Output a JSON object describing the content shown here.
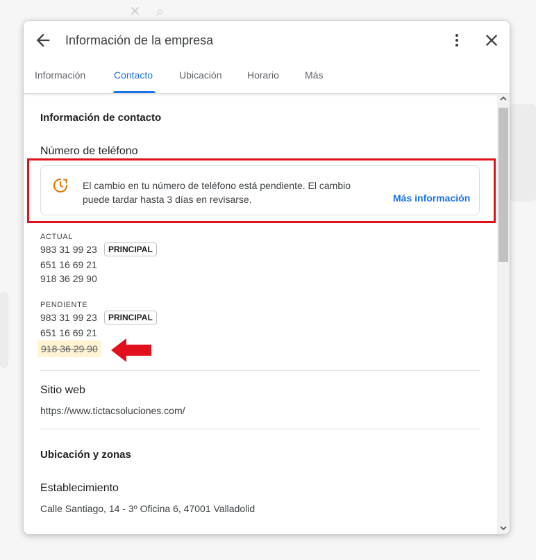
{
  "dialog": {
    "title": "Información de la empresa"
  },
  "tabs": [
    {
      "label": "Información",
      "active": false
    },
    {
      "label": "Contacto",
      "active": true
    },
    {
      "label": "Ubicación",
      "active": false
    },
    {
      "label": "Horario",
      "active": false
    },
    {
      "label": "Más",
      "active": false
    }
  ],
  "contact": {
    "section_title": "Información de contacto",
    "phone_title": "Número de teléfono",
    "notice": {
      "text": "El cambio en tu número de teléfono está pendiente. El cambio puede tardar hasta 3 días en revisarse.",
      "link": "Más información"
    },
    "actual": {
      "label": "ACTUAL",
      "phones": [
        "983 31 99 23",
        "651 16 69 21",
        "918 36 29 90"
      ],
      "primary_badge": "PRINCIPAL"
    },
    "pending": {
      "label": "PENDIENTE",
      "phones": [
        "983 31 99 23",
        "651 16 69 21"
      ],
      "removed_phone": "918 36 29 90",
      "primary_badge": "PRINCIPAL"
    },
    "website_title": "Sitio web",
    "website_url": "https://www.tictacsoluciones.com/"
  },
  "location": {
    "section_title": "Ubicación y zonas",
    "establishment_title": "Establecimiento",
    "address": "Calle Santiago, 14 - 3º Oficina 6, 47001 Valladolid"
  },
  "colors": {
    "accent": "#1a73e8",
    "highlight": "#e2101d",
    "pending_icon": "#e37400",
    "removed_bg": "#fef3d3"
  },
  "icons": {
    "back": "arrow-left-icon",
    "more": "more-vert-icon",
    "close": "close-icon",
    "pending": "clock-refresh-icon"
  }
}
